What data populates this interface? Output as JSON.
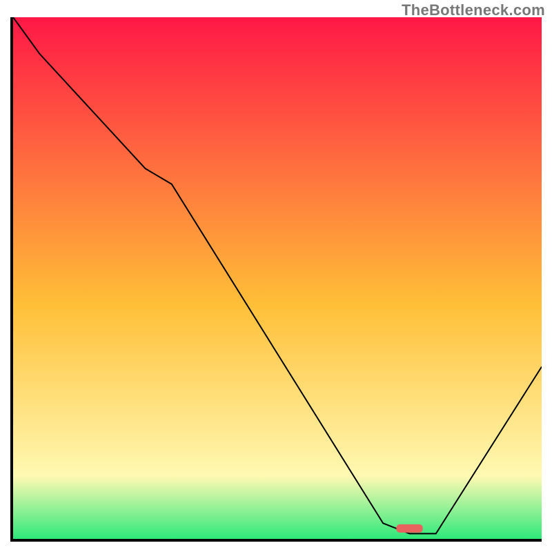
{
  "watermark": "TheBottleneck.com",
  "colors": {
    "gradient_top": "#ff1846",
    "gradient_mid": "#ffbf37",
    "gradient_low": "#fff9b2",
    "gradient_bottom": "#2ee97b",
    "curve": "#000000",
    "marker": "#e9635e",
    "axis": "#000000"
  },
  "marker": {
    "x_pct": 75,
    "y_pct": 98,
    "width_pct": 5
  },
  "chart_data": {
    "type": "line",
    "title": "",
    "xlabel": "",
    "ylabel": "",
    "xlim": [
      0,
      100
    ],
    "ylim": [
      0,
      100
    ],
    "grid": false,
    "legend": false,
    "series": [
      {
        "name": "bottleneck-curve",
        "x": [
          0,
          5,
          25,
          30,
          70,
          75,
          80,
          100
        ],
        "values": [
          100,
          93,
          71,
          68,
          3,
          1,
          1,
          33
        ]
      }
    ],
    "annotations": {
      "background": "vertical red-to-green gradient",
      "marker": "small rounded red pill at curve minimum near x≈75–80"
    }
  }
}
